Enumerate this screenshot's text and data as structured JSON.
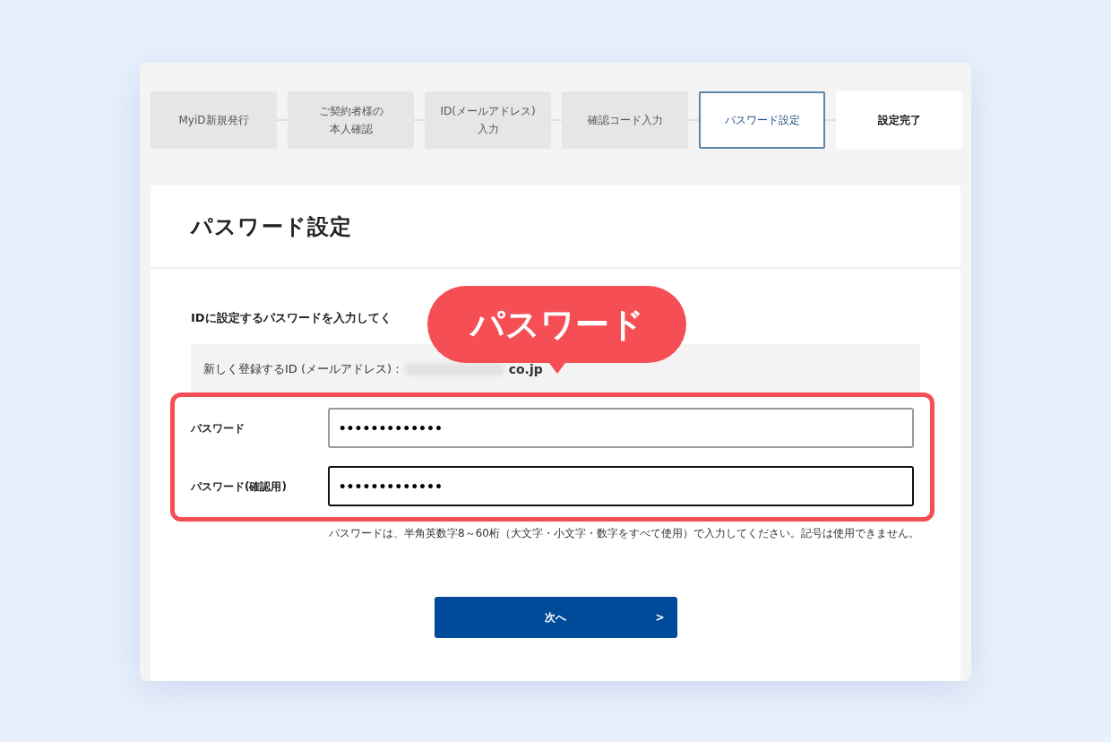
{
  "steps": [
    {
      "lines": [
        "MyiD新規発行"
      ],
      "done": true,
      "selected": false
    },
    {
      "lines": [
        "ご契約者様の",
        "本人確認"
      ],
      "done": true,
      "selected": false
    },
    {
      "lines": [
        "ID(メールアドレス)",
        "入力"
      ],
      "done": true,
      "selected": false
    },
    {
      "lines": [
        "確認コード入力"
      ],
      "done": true,
      "selected": false
    },
    {
      "lines": [
        "パスワード設定"
      ],
      "done": false,
      "selected": true
    },
    {
      "lines": [
        "設定完了"
      ],
      "done": false,
      "selected": false
    }
  ],
  "title": "パスワード設定",
  "instruction": "IDに設定するパスワードを入力してく",
  "callout": "パスワード",
  "id_row": {
    "label": "新しく登録するID (メールアドレス) :",
    "value_visible": "co.jp"
  },
  "fields": [
    {
      "label": "パスワード",
      "value": "•••••••••••••",
      "focused": false
    },
    {
      "label": "パスワード(確認用)",
      "value": "•••••••••••••",
      "focused": true
    }
  ],
  "hint": "パスワードは、半角英数字8～60桁（大文字・小文字・数字をすべて使用）で入力してください。記号は使用できません。",
  "next_button": {
    "label": "次へ",
    "arrow": ">"
  }
}
